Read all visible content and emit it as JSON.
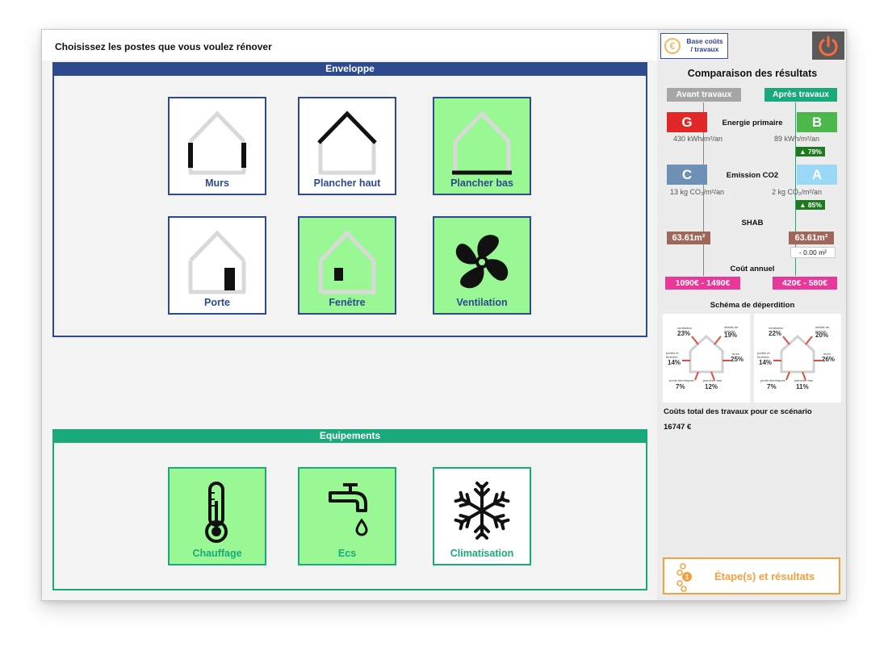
{
  "prompt": "Choisissez les postes que vous voulez rénover",
  "enveloppe": {
    "title": "Enveloppe",
    "items": [
      {
        "label": "Murs",
        "selected": false
      },
      {
        "label": "Plancher haut",
        "selected": false
      },
      {
        "label": "Plancher bas",
        "selected": true
      },
      {
        "label": "Porte",
        "selected": false
      },
      {
        "label": "Fenêtre",
        "selected": true
      },
      {
        "label": "Ventilation",
        "selected": true
      }
    ]
  },
  "equipements": {
    "title": "Equipements",
    "items": [
      {
        "label": "Chauffage",
        "selected": true
      },
      {
        "label": "Ecs",
        "selected": true
      },
      {
        "label": "Climatisation",
        "selected": false
      }
    ]
  },
  "side": {
    "base_btn_label_1": "Base coûts",
    "base_btn_label_2": "/ travaux",
    "compare_title": "Comparaison des résultats",
    "before_label": "Avant travaux",
    "after_label": "Après travaux",
    "energy": {
      "label": "Energie primaire",
      "before_class": "G",
      "after_class": "B",
      "before_value": "430 kWh/m²/an",
      "after_value": "89 kWh/m²/an",
      "delta": "▲ 79%",
      "before_color": "#e12727",
      "after_color": "#4cb84c"
    },
    "co2": {
      "label": "Emission CO2",
      "before_class": "C",
      "after_class": "A",
      "before_value": "13 kg CO₂/m²/an",
      "after_value": "2 kg CO₂/m²/an",
      "delta": "▲ 85%",
      "before_color": "#6e90b4",
      "after_color": "#9bd8f5"
    },
    "shab": {
      "label": "SHAB",
      "before_value": "63.61m²",
      "after_value": "63.61m²",
      "delta": "- 0.00 m²",
      "color": "#a0665a"
    },
    "cost": {
      "label": "Coût annuel",
      "before_value": "1090€ - 1490€",
      "after_value": "420€ - 580€",
      "color": "#e8399a"
    },
    "schema": {
      "label": "Schéma de déperdition",
      "before": {
        "ventilation_label": "ventilation",
        "ventilation": "23%",
        "plafond_label": "défaits de plafond",
        "plafond": "19%",
        "portes_label": "portes et fenêtres",
        "portes": "14%",
        "murs_label": "murs",
        "murs": "25%",
        "ponts_label": "ponts thermiques",
        "ponts": "7%",
        "plancher_label": "plancher bas",
        "plancher": "12%"
      },
      "after": {
        "ventilation_label": "ventilation",
        "ventilation": "22%",
        "plafond_label": "défaits de plafond",
        "plafond": "20%",
        "portes_label": "portes et fenêtres",
        "portes": "14%",
        "murs_label": "murs",
        "murs": "26%",
        "ponts_label": "ponts thermiques",
        "ponts": "7%",
        "plancher_label": "plancher bas",
        "plancher": "11%"
      }
    },
    "total_label": "Coûts total des travaux pour ce scénario",
    "total_value": "16747 €",
    "steps_label": "Étape(s) et résultats"
  }
}
